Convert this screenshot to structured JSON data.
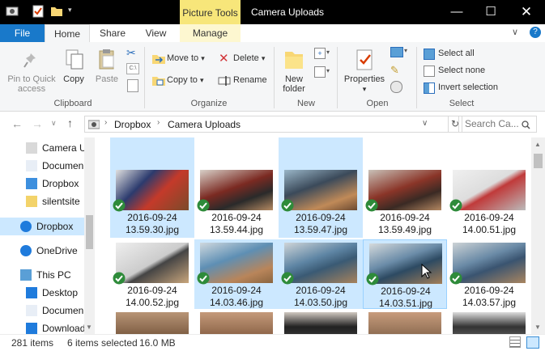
{
  "window": {
    "context_tab": "Picture Tools",
    "title": "Camera Uploads"
  },
  "tabs": {
    "file": "File",
    "home": "Home",
    "share": "Share",
    "view": "View",
    "manage": "Manage"
  },
  "ribbon": {
    "clipboard": {
      "label": "Clipboard",
      "pin_line1": "Pin to Quick",
      "pin_line2": "access",
      "copy": "Copy",
      "paste": "Paste"
    },
    "organize": {
      "label": "Organize",
      "move_to": "Move to",
      "copy_to": "Copy to",
      "delete": "Delete",
      "rename": "Rename"
    },
    "new": {
      "label": "New",
      "new_folder_line1": "New",
      "new_folder_line2": "folder"
    },
    "open": {
      "label": "Open",
      "properties": "Properties"
    },
    "select": {
      "label": "Select",
      "select_all": "Select all",
      "select_none": "Select none",
      "invert_selection": "Invert selection"
    }
  },
  "address": {
    "crumbs": [
      "Dropbox",
      "Camera Uploads"
    ],
    "search_placeholder": "Search Ca..."
  },
  "nav": [
    {
      "label": "Camera U",
      "icon": "camera-uploads-folder-icon"
    },
    {
      "label": "Documen",
      "icon": "documents-icon"
    },
    {
      "label": "Dropbox",
      "icon": "dropbox-folder-icon"
    },
    {
      "label": "silentsite",
      "icon": "folder-icon"
    },
    {
      "label": "Dropbox",
      "icon": "dropbox-icon"
    },
    {
      "label": "OneDrive",
      "icon": "onedrive-icon"
    },
    {
      "label": "This PC",
      "icon": "this-pc-icon"
    },
    {
      "label": "Desktop",
      "icon": "desktop-icon"
    },
    {
      "label": "Documen",
      "icon": "documents-icon"
    },
    {
      "label": "Download",
      "icon": "downloads-icon"
    }
  ],
  "files": [
    {
      "line1": "2016-09-24",
      "line2": "13.59.30.jpg",
      "selected": true
    },
    {
      "line1": "2016-09-24",
      "line2": "13.59.44.jpg",
      "selected": false
    },
    {
      "line1": "2016-09-24",
      "line2": "13.59.47.jpg",
      "selected": true
    },
    {
      "line1": "2016-09-24",
      "line2": "13.59.49.jpg",
      "selected": false
    },
    {
      "line1": "2016-09-24",
      "line2": "14.00.51.jpg",
      "selected": false
    },
    {
      "line1": "2016-09-24",
      "line2": "14.00.52.jpg",
      "selected": false
    },
    {
      "line1": "2016-09-24",
      "line2": "14.03.46.jpg",
      "selected": true
    },
    {
      "line1": "2016-09-24",
      "line2": "14.03.50.jpg",
      "selected": true
    },
    {
      "line1": "2016-09-24",
      "line2": "14.03.51.jpg",
      "selected": true
    },
    {
      "line1": "2016-09-24",
      "line2": "14.03.57.jpg",
      "selected": false
    }
  ],
  "status": {
    "count": "281 items",
    "selection": "6 items selected",
    "size": "16.0 MB"
  },
  "colors": {
    "accent": "#1979ca",
    "selection": "#cce8ff",
    "context_tab": "#f7e67a"
  }
}
